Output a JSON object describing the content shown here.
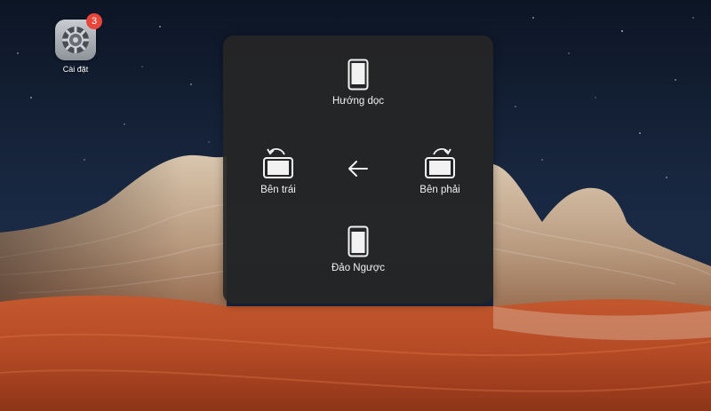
{
  "home": {
    "apps": [
      {
        "label": "Cài đặt",
        "badge": "3",
        "icon": "gear-icon"
      }
    ]
  },
  "rotate_menu": {
    "options": {
      "portrait": {
        "label": "Hướng dọc",
        "icon": "ipad-portrait-icon"
      },
      "left": {
        "label": "Bên trái",
        "icon": "rotate-left-icon"
      },
      "right": {
        "label": "Bên phải",
        "icon": "rotate-right-icon"
      },
      "upside_down": {
        "label": "Đảo Ngược",
        "icon": "ipad-upside-down-icon"
      }
    },
    "back_icon": "back-arrow-icon"
  },
  "colors": {
    "panel": "#262626",
    "badge": "#e8463b",
    "text": "#f2f2f2"
  }
}
